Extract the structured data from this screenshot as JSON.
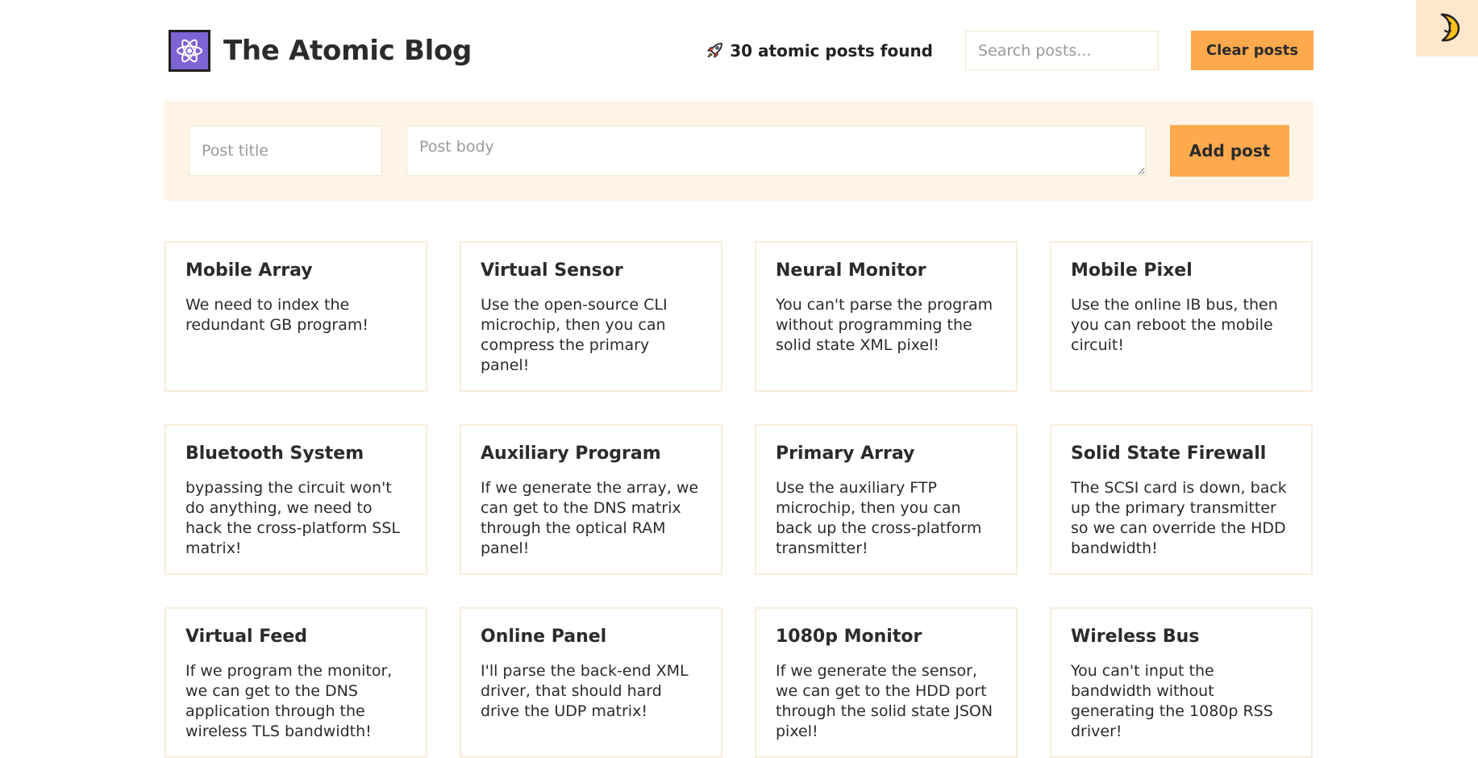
{
  "header": {
    "title": "The Atomic Blog",
    "logo_icon": "atom-icon",
    "post_count_text": "30 atomic posts found",
    "post_count_icon": "rocket-icon",
    "search_placeholder": "Search posts...",
    "clear_button": "Clear posts"
  },
  "theme_toggle": {
    "icon": "moon-face-icon"
  },
  "form": {
    "title_placeholder": "Post title",
    "body_placeholder": "Post body",
    "add_button": "Add post"
  },
  "posts": [
    {
      "title": "Mobile Array",
      "body": "We need to index the redundant GB program!"
    },
    {
      "title": "Virtual Sensor",
      "body": "Use the open-source CLI microchip, then you can compress the primary panel!"
    },
    {
      "title": "Neural Monitor",
      "body": "You can't parse the program without programming the solid state XML pixel!"
    },
    {
      "title": "Mobile Pixel",
      "body": "Use the online IB bus, then you can reboot the mobile circuit!"
    },
    {
      "title": "Bluetooth System",
      "body": "bypassing the circuit won't do anything, we need to hack the cross-platform SSL matrix!"
    },
    {
      "title": "Auxiliary Program",
      "body": "If we generate the array, we can get to the DNS matrix through the optical RAM panel!"
    },
    {
      "title": "Primary Array",
      "body": "Use the auxiliary FTP microchip, then you can back up the cross-platform transmitter!"
    },
    {
      "title": "Solid State Firewall",
      "body": "The SCSI card is down, back up the primary transmitter so we can override the HDD bandwidth!"
    },
    {
      "title": "Virtual Feed",
      "body": "If we program the monitor, we can get to the DNS application through the wireless TLS bandwidth!"
    },
    {
      "title": "Online Panel",
      "body": "I'll parse the back-end XML driver, that should hard drive the UDP matrix!"
    },
    {
      "title": "1080p Monitor",
      "body": "If we generate the sensor, we can get to the HDD port through the solid state JSON pixel!"
    },
    {
      "title": "Wireless Bus",
      "body": "You can't input the bandwidth without generating the 1080p RSS driver!"
    }
  ],
  "colors": {
    "accent": "#ffa94d",
    "panel_bg": "#fff4e6",
    "logo_bg": "#7c64d4"
  }
}
